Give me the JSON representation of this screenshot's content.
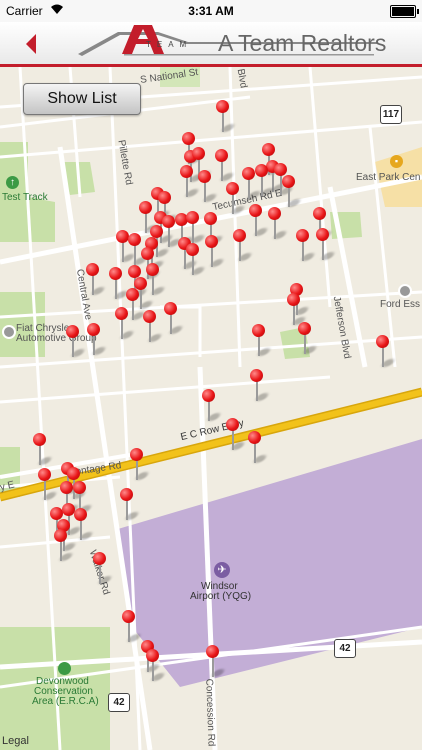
{
  "status_bar": {
    "carrier": "Carrier",
    "time": "3:31 AM"
  },
  "header": {
    "logo_team_text": "TEAM",
    "brand_name": "A Team Realtors"
  },
  "toolbar": {
    "show_list_label": "Show List"
  },
  "map": {
    "road_labels": {
      "national": "S National St",
      "tecumseh": "Tecumseh Rd E",
      "central": "Central Ave",
      "pillette": "Pillette Rd",
      "jefferson": "Jefferson Blvd",
      "ecrow": "E C Row Expy",
      "frontage": "Frontage Rd",
      "expy_e_west": "y E",
      "walker": "Walker Rd",
      "concession": "Concession Rd",
      "blvd_top": "Blvd"
    },
    "poi_labels": {
      "test_track": "Test Track",
      "fiat": "Fiat Chrysler",
      "fiat2": "Automotive Group",
      "east_park": "East Park Cen",
      "ford": "Ford Ess",
      "airport": "Windsor",
      "airport2": "Airport (YQG)",
      "devonwood": "Devonwood",
      "devonwood2": "Conservation",
      "devonwood3": "Area (E.R.C.A)"
    },
    "route_shields": [
      "117",
      "42",
      "42"
    ],
    "legal_label": "Legal",
    "icons": [
      "back-arrow-icon",
      "test-track-icon",
      "fiat-poi-icon",
      "east-park-icon",
      "ford-poi-icon",
      "airport-icon",
      "devonwood-icon",
      "map-pin-icon"
    ],
    "colors": {
      "pin": "#e81416",
      "airport_zone": "#c3aed6",
      "highway": "#f2c21a",
      "park": "#c8e0a8",
      "header_accent": "#c31d2b"
    }
  }
}
